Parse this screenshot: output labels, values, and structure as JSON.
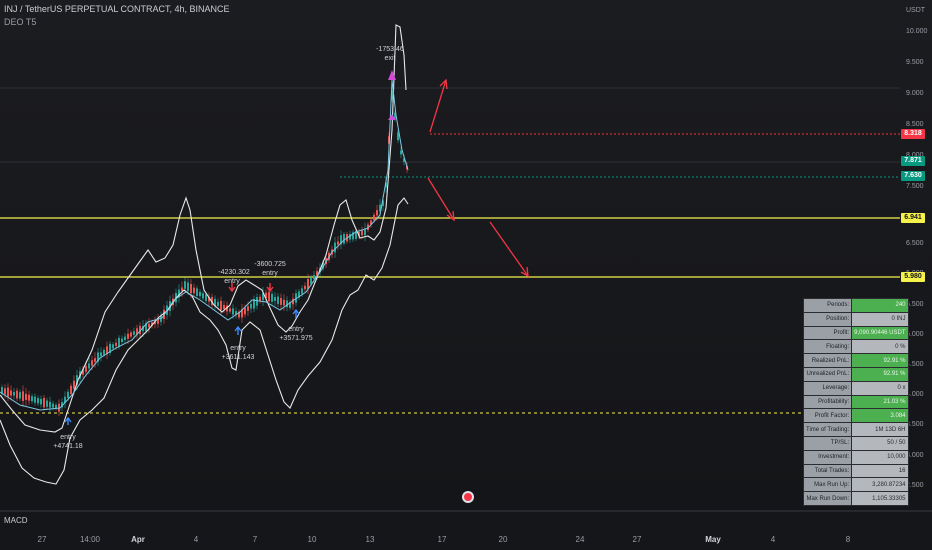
{
  "header": {
    "title": "INJ / TetherUS PERPETUAL CONTRACT, 4h, BINANCE",
    "indicator": "DEO T5",
    "currency": "USDT"
  },
  "price_axis": {
    "ticks": [
      "10.000",
      "9.500",
      "9.000",
      "8.500",
      "8.000",
      "7.500",
      "7.000",
      "6.500",
      "6.000",
      "5.500",
      "5.000",
      "4.500",
      "4.000",
      "3.500",
      "3.000",
      "2.500"
    ]
  },
  "price_labels": [
    {
      "value": "8.318",
      "color": "#f23645",
      "text_color": "#ffffff"
    },
    {
      "value": "7.871",
      "color": "#089981",
      "text_color": "#ffffff"
    },
    {
      "value": "7.630",
      "color": "#089981",
      "text_color": "#ffffff"
    },
    {
      "value": "6.941",
      "color": "#f5f24b",
      "text_color": "#111111"
    },
    {
      "value": "5.980",
      "color": "#f5f24b",
      "text_color": "#111111"
    }
  ],
  "annotations": {
    "exit_value": "-1753.46",
    "exit_label": "exit",
    "trade1_label": "entry",
    "trade1_value": "+4741.18",
    "trade2_value": "-4230.302",
    "trade2_label": "entry",
    "trade3_label": "entry",
    "trade3_value": "+3611.143",
    "trade4_value": "-3600.725",
    "trade4_label": "entry",
    "trade5_label": "entry",
    "trade5_value": "+3571.975"
  },
  "stats_table": [
    {
      "label": "Periods:",
      "value": "240",
      "green": true
    },
    {
      "label": "Position:",
      "value": "0 INJ",
      "green": false
    },
    {
      "label": "Profit:",
      "value": "9,090.90446 USDT",
      "green": true
    },
    {
      "label": "Floating:",
      "value": "0 %",
      "green": false
    },
    {
      "label": "Realized PnL:",
      "value": "92.91 %",
      "green": true
    },
    {
      "label": "Unrealized PnL:",
      "value": "92.91 %",
      "green": true
    },
    {
      "label": "Leverage:",
      "value": "0 x",
      "green": false
    },
    {
      "label": "Profitability:",
      "value": "21.03 %",
      "green": true
    },
    {
      "label": "Profit Factor:",
      "value": "3.084",
      "green": true
    },
    {
      "label": "Time of Trading:",
      "value": "1M 13D 6H",
      "green": false
    },
    {
      "label": "TP/SL:",
      "value": "50 / 50",
      "green": false
    },
    {
      "label": "Investment:",
      "value": "10,000",
      "green": false
    },
    {
      "label": "Total Trades:",
      "value": "16",
      "green": false
    },
    {
      "label": "Max Run Up:",
      "value": "3,280.87234",
      "green": false
    },
    {
      "label": "Max Run Down:",
      "value": "1,105.33305",
      "green": false
    }
  ],
  "bottom_pane": {
    "label": "MACD"
  },
  "time_axis": {
    "labels": [
      {
        "text": "27",
        "bold": false
      },
      {
        "text": "14:00",
        "bold": false
      },
      {
        "text": "Apr",
        "bold": true
      },
      {
        "text": "4",
        "bold": false
      },
      {
        "text": "7",
        "bold": false
      },
      {
        "text": "10",
        "bold": false
      },
      {
        "text": "13",
        "bold": false
      },
      {
        "text": "17",
        "bold": false
      },
      {
        "text": "20",
        "bold": false
      },
      {
        "text": "24",
        "bold": false
      },
      {
        "text": "27",
        "bold": false
      },
      {
        "text": "May",
        "bold": true
      },
      {
        "text": "4",
        "bold": false
      },
      {
        "text": "8",
        "bold": false
      }
    ]
  }
}
